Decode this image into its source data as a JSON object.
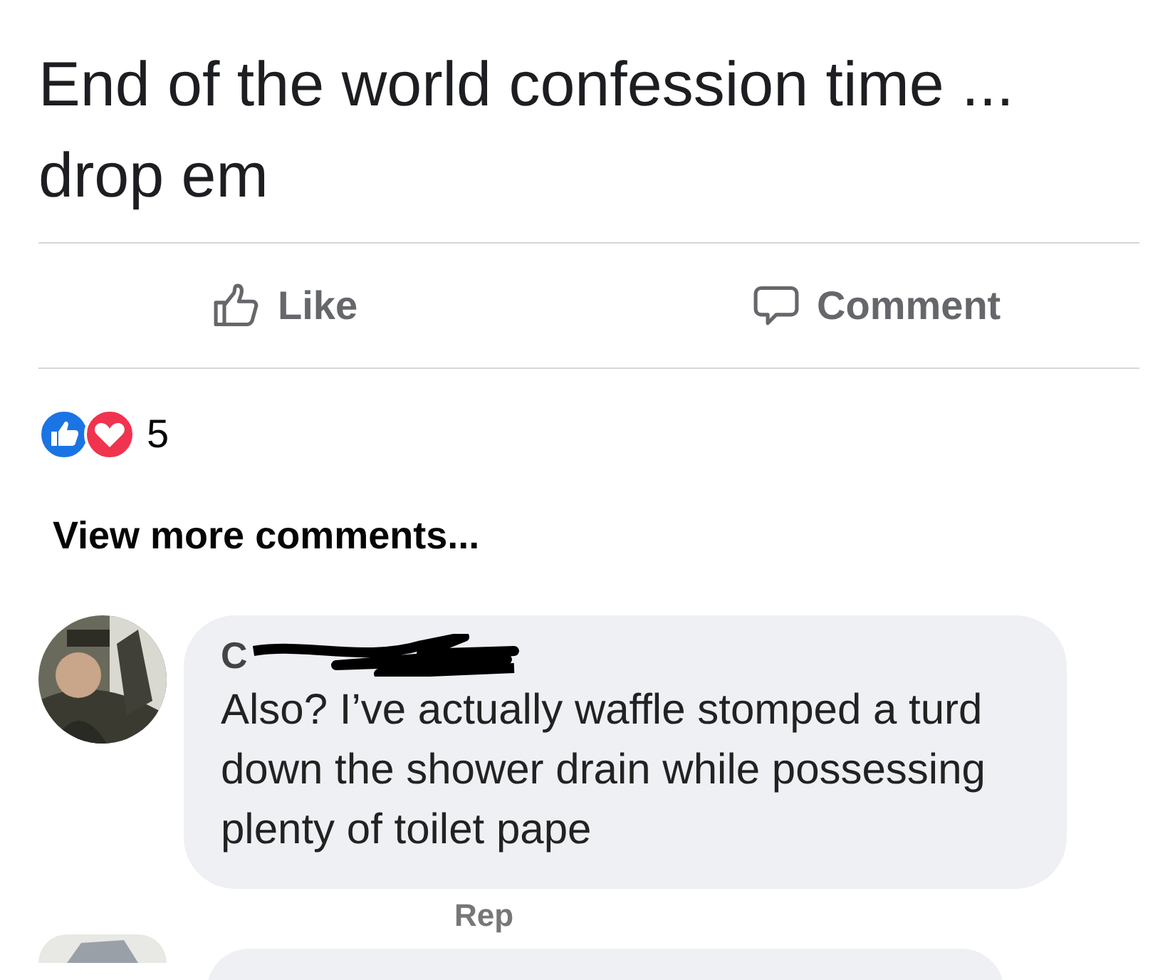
{
  "post": {
    "text": "End of the world confession time ... drop em"
  },
  "actions": [
    {
      "kind": "like",
      "label": "Like"
    },
    {
      "kind": "comment",
      "label": "Comment"
    }
  ],
  "reactions": {
    "count": "5"
  },
  "view_more": "View more comments...",
  "comments": [
    {
      "author": "C",
      "text": "Also? I’ve actually waffle stomped a turd down the shower drain while possessing plenty of toilet pape",
      "reply": "Rep"
    }
  ]
}
